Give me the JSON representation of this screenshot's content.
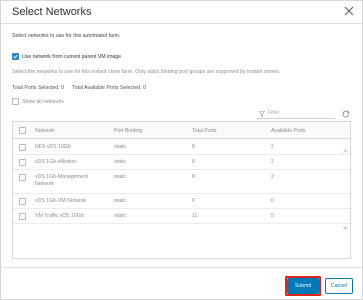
{
  "dialog": {
    "title": "Select Networks",
    "description": "Select networks to use for this automated farm.",
    "use_parent_label": "Use network from current parent VM image",
    "use_parent_checked": true,
    "instruction": "Select the networks to use for this instant clone farm. Only static binding port groups are supported by instant clones.",
    "total_ports": "Total Ports Selected: 0",
    "total_available": "Total Available Ports Selected: 0",
    "show_all_label": "Show all networks",
    "show_all_checked": false,
    "filter_placeholder": "Filter"
  },
  "table": {
    "headers": [
      "Network",
      "Port Binding",
      "Total Ports",
      "Available Ports"
    ],
    "rows": [
      {
        "network": "NFS vDS 10Gb",
        "binding": "static",
        "total": "8",
        "available": "2"
      },
      {
        "network": "vDS 1Gb-vMotion",
        "binding": "static",
        "total": "8",
        "available": "2"
      },
      {
        "network": "vDS 1Gb-Management Network",
        "binding": "static",
        "total": "8",
        "available": "2"
      },
      {
        "network": "vDS 1Gb-VM Network",
        "binding": "static",
        "total": "0",
        "available": "0"
      },
      {
        "network": "VM Traffic vDS 10Gb",
        "binding": "static",
        "total": "11",
        "available": "5"
      }
    ]
  },
  "footer": {
    "submit_label": "Submit",
    "cancel_label": "Cancel"
  },
  "colors": {
    "primary": "#0079b8",
    "highlight": "#e0241a",
    "checkbox": "#2b8bc9"
  }
}
